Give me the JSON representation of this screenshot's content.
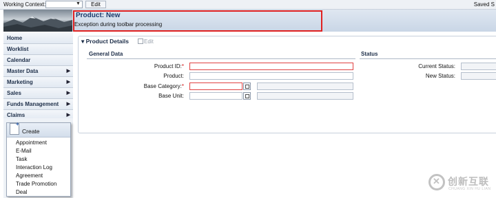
{
  "topbar": {
    "working_context_label": "Working Context:",
    "working_context_value": "",
    "edit_label": "Edit",
    "saved_label": "Saved S"
  },
  "header": {
    "title": "Product: New",
    "message": "Exception during toolbar processing"
  },
  "nav": {
    "items": [
      {
        "label": "Home",
        "has_submenu": false
      },
      {
        "label": "Worklist",
        "has_submenu": false
      },
      {
        "label": "Calendar",
        "has_submenu": false
      },
      {
        "label": "Master Data",
        "has_submenu": true
      },
      {
        "label": "Marketing",
        "has_submenu": true
      },
      {
        "label": "Sales",
        "has_submenu": true
      },
      {
        "label": "Funds Management",
        "has_submenu": true
      },
      {
        "label": "Claims",
        "has_submenu": true
      }
    ]
  },
  "create_menu": {
    "title": "Create",
    "items": [
      "Appointment",
      "E-Mail",
      "Task",
      "Interaction Log",
      "Agreement",
      "Trade Promotion",
      "Deal"
    ]
  },
  "product_details": {
    "tab_label": "Product Details",
    "edit_label": "Edit",
    "general_section": "General Data",
    "status_section": "Status",
    "fields": {
      "product_id": {
        "label": "Product ID:",
        "required": "*",
        "value": ""
      },
      "product": {
        "label": "Product:",
        "value": ""
      },
      "base_category": {
        "label": "Base Category:",
        "required": "*",
        "value": ""
      },
      "base_unit": {
        "label": "Base Unit:",
        "value": ""
      }
    },
    "status_fields": {
      "current_status": {
        "label": "Current Status:",
        "value": ""
      },
      "new_status": {
        "label": "New Status:",
        "value": ""
      }
    }
  },
  "watermark": {
    "symbol": "✕",
    "name": "创新互联",
    "subtitle": "CHUANG XIN HU LIAN"
  },
  "colors": {
    "highlight_border": "#e02020",
    "nav_text": "#1d2e48",
    "required": "#d01010"
  }
}
